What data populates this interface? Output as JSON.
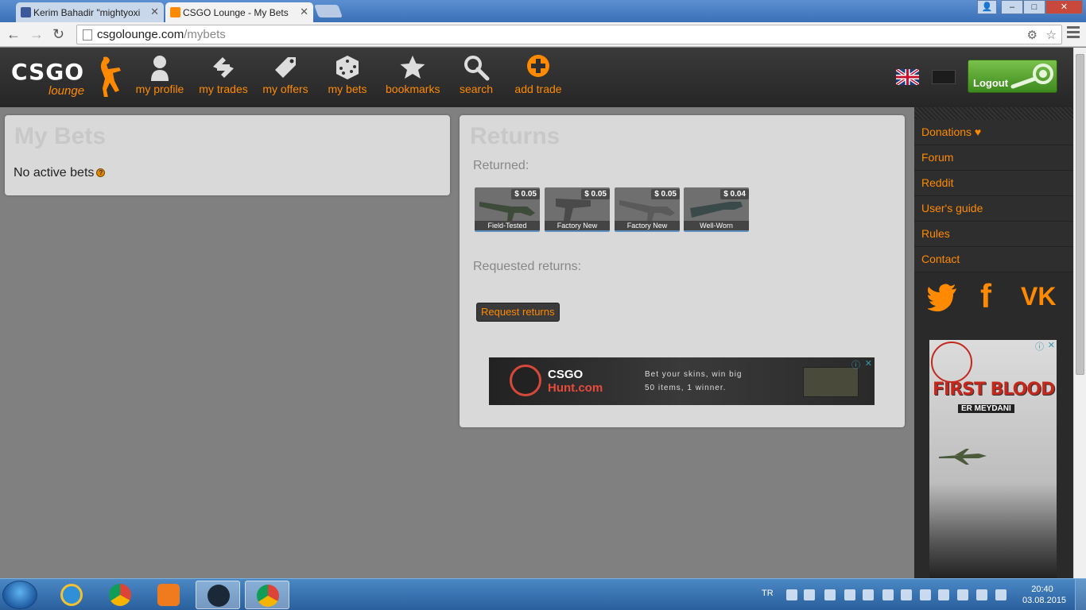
{
  "browser": {
    "tabs": [
      {
        "title": "Kerim Bahadir \"mightyoxi",
        "active": false
      },
      {
        "title": "CSGO Lounge - My Bets",
        "active": true
      }
    ],
    "url_host": "csgolounge.com",
    "url_path": "/mybets",
    "window_controls": {
      "minimize": "–",
      "maximize": "□",
      "close": "✕",
      "profile": "👤"
    }
  },
  "site": {
    "logo_main": "CSGO",
    "logo_sub": "lounge",
    "nav": [
      {
        "label": "my profile",
        "icon": "user-icon"
      },
      {
        "label": "my trades",
        "icon": "trades-icon"
      },
      {
        "label": "my offers",
        "icon": "tag-icon"
      },
      {
        "label": "my bets",
        "icon": "dice-icon"
      },
      {
        "label": "bookmarks",
        "icon": "star-icon"
      },
      {
        "label": "search",
        "icon": "magnifier-icon"
      },
      {
        "label": "add trade",
        "icon": "plus-circle-icon"
      }
    ],
    "logout_label": "Logout",
    "accent_color": "#ff8a00"
  },
  "mybets": {
    "title": "My Bets",
    "empty_text": "No active bets",
    "help": "?"
  },
  "returns": {
    "title": "Returns",
    "returned_label": "Returned:",
    "items": [
      {
        "price": "$ 0.05",
        "condition": "Field-Tested"
      },
      {
        "price": "$ 0.05",
        "condition": "Factory New"
      },
      {
        "price": "$ 0.05",
        "condition": "Factory New"
      },
      {
        "price": "$ 0.04",
        "condition": "Well-Worn"
      }
    ],
    "requested_label": "Requested returns:",
    "request_button": "Request returns",
    "ad": {
      "brand_top": "CSGO",
      "brand_bottom": "Hunt.com",
      "tagline_1": "Bet your skins, win big",
      "tagline_2": "50 items, 1 winner.",
      "info": "ⓘ",
      "close": "✕"
    }
  },
  "sidebar": {
    "links": [
      "Donations ♥",
      "Forum",
      "Reddit",
      "User's guide",
      "Rules",
      "Contact"
    ],
    "social": [
      "twitter-icon",
      "facebook-icon",
      "vk-icon"
    ],
    "social_vk_text": "VK",
    "social_fb_text": "f",
    "ad": {
      "title": "FIRST BLOOD",
      "subtitle": "ER MEYDANI",
      "info": "ⓘ",
      "close": "✕"
    }
  },
  "taskbar": {
    "language": "TR",
    "time": "20:40",
    "date": "03.08.2015"
  }
}
